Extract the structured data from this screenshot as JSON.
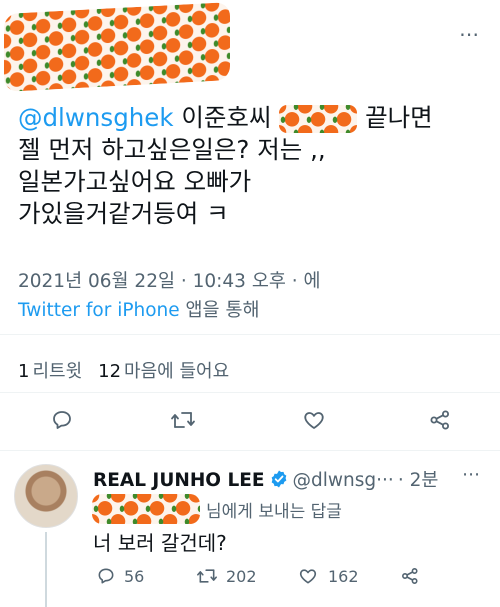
{
  "tweet": {
    "top_more": "⋯",
    "mention": "@dlwnsghek",
    "text_part1": " 이준호씨 ",
    "text_part2": " 끝나면",
    "line2": "젤 먼저 하고싶은일은? 저는 ,,",
    "line3": "일본가고싶어요 오빠가",
    "line4": "가있을거같거등여 ㅋ",
    "timestamp": "2021년 06월 22일 · 10:43 오후 · 에",
    "source": "Twitter for iPhone",
    "source_suffix": " 앱을 통해"
  },
  "stats": {
    "retweet_count": "1",
    "retweet_label": "리트윗",
    "like_count": "12",
    "like_label": "마음에 들어요"
  },
  "reply": {
    "name": "REAL JUNHO LEE",
    "handle": "@dlwnsg···",
    "time": "· 2분",
    "more": "⋯",
    "replying_suffix": "님에게 보내는 답글",
    "text": "너 보러 갈건데?",
    "reply_count": "56",
    "retweet_count": "202",
    "like_count": "162"
  },
  "colors": {
    "accent": "#1d9bf0",
    "muted": "#536471",
    "verified": "#1d9bf0",
    "orange": "#f26a1b"
  },
  "icons": [
    "more-icon",
    "reply-icon",
    "retweet-icon",
    "like-icon",
    "share-icon",
    "verified-badge-icon"
  ]
}
